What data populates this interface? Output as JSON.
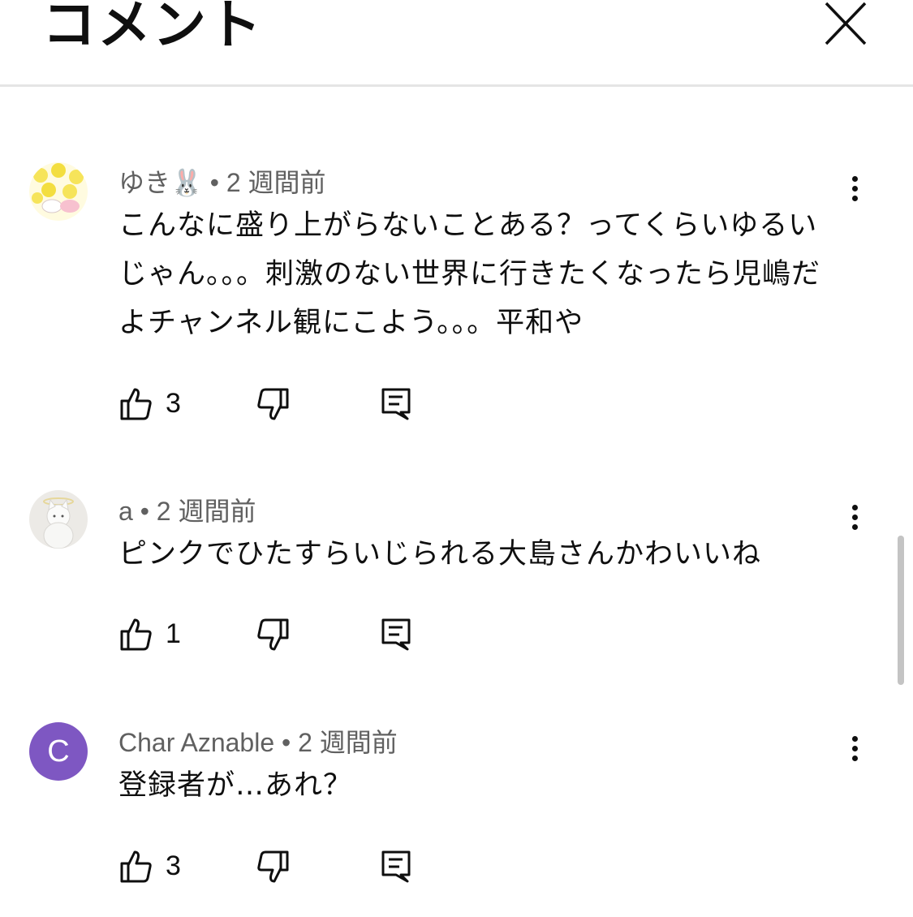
{
  "header": {
    "title": "コメント",
    "close_icon": "close-icon"
  },
  "comments": [
    {
      "author": "ゆき🐰",
      "separator": "•",
      "time": "2 週間前",
      "text": "こんなに盛り上がらないことある？ってくらいゆるいじゃん。。。刺激のない世界に行きたくなったら児嶋だよチャンネル観にこよう。。。平和や",
      "likes": "3",
      "avatar_icon": "floral-avatar-icon"
    },
    {
      "author": "a",
      "separator": "•",
      "time": "2 週間前",
      "text": "ピンクでひたすらいじられる大島さんかわいいね",
      "likes": "1",
      "avatar_icon": "cat-avatar-icon"
    },
    {
      "author": "Char Aznable",
      "separator": "•",
      "time": "2 週間前",
      "text": "登録者が…あれ？",
      "likes": "3",
      "avatar_letter": "C",
      "avatar_color": "#7e57c2"
    }
  ]
}
